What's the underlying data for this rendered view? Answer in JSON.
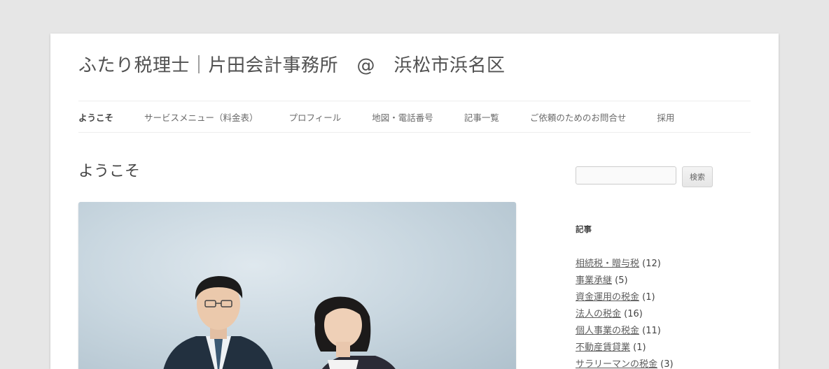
{
  "site": {
    "title": "ふたり税理士｜片田会計事務所　@　浜松市浜名区"
  },
  "nav": {
    "items": [
      {
        "label": "ようこそ",
        "current": true
      },
      {
        "label": "サービスメニュー（料金表）"
      },
      {
        "label": "プロフィール"
      },
      {
        "label": "地図・電話番号"
      },
      {
        "label": "記事一覧"
      },
      {
        "label": "ご依頼のためのお問合せ"
      },
      {
        "label": "採用"
      }
    ]
  },
  "main": {
    "title": "ようこそ"
  },
  "sidebar": {
    "search": {
      "value": "",
      "button_label": "検索"
    },
    "widget_title": "記事",
    "categories": [
      {
        "name": "相続税・贈与税",
        "count": "(12)"
      },
      {
        "name": "事業承継",
        "count": "(5)"
      },
      {
        "name": "資金運用の税金",
        "count": "(1)"
      },
      {
        "name": "法人の税金",
        "count": "(16)"
      },
      {
        "name": "個人事業の税金",
        "count": "(11)"
      },
      {
        "name": "不動産賃貸業",
        "count": "(1)"
      },
      {
        "name": "サラリーマンの税金",
        "count": "(3)"
      }
    ]
  },
  "colors": {
    "page_bg": "#e6e6e6",
    "content_bg": "#ffffff",
    "text": "#444444",
    "link": "#5e5e5e"
  }
}
